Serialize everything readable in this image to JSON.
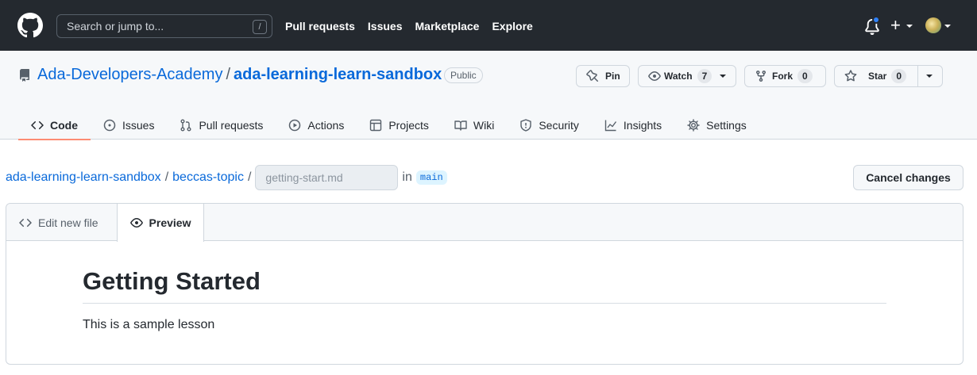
{
  "header": {
    "search_placeholder": "Search or jump to...",
    "search_shortcut": "/",
    "nav": [
      "Pull requests",
      "Issues",
      "Marketplace",
      "Explore"
    ],
    "plus_label": "+",
    "notification_color": "#2f81f7"
  },
  "repo": {
    "owner": "Ada-Developers-Academy",
    "separator": "/",
    "name": "ada-learning-learn-sandbox",
    "visibility": "Public",
    "pin_label": "Pin",
    "watch_label": "Watch",
    "watch_count": "7",
    "fork_label": "Fork",
    "fork_count": "0",
    "star_label": "Star",
    "star_count": "0"
  },
  "tabs": [
    {
      "label": "Code",
      "icon": "code-icon",
      "active": true
    },
    {
      "label": "Issues",
      "icon": "issue-icon"
    },
    {
      "label": "Pull requests",
      "icon": "pull-request-icon"
    },
    {
      "label": "Actions",
      "icon": "play-icon"
    },
    {
      "label": "Projects",
      "icon": "table-icon"
    },
    {
      "label": "Wiki",
      "icon": "book-icon"
    },
    {
      "label": "Security",
      "icon": "shield-icon"
    },
    {
      "label": "Insights",
      "icon": "graph-icon"
    },
    {
      "label": "Settings",
      "icon": "gear-icon"
    }
  ],
  "path": {
    "root": "ada-learning-learn-sandbox",
    "sep1": "/",
    "folder": "beccas-topic",
    "sep2": "/",
    "filename_placeholder": "getting-start.md",
    "in_label": "in",
    "branch": "main",
    "cancel_label": "Cancel changes"
  },
  "editor": {
    "edit_tab_label": "Edit new file",
    "preview_tab_label": "Preview",
    "preview_heading": "Getting Started",
    "preview_text": "This is a sample lesson"
  },
  "colors": {
    "header_bg": "#24292f",
    "link": "#0969da",
    "active_tab_underline": "#fd8c73"
  }
}
